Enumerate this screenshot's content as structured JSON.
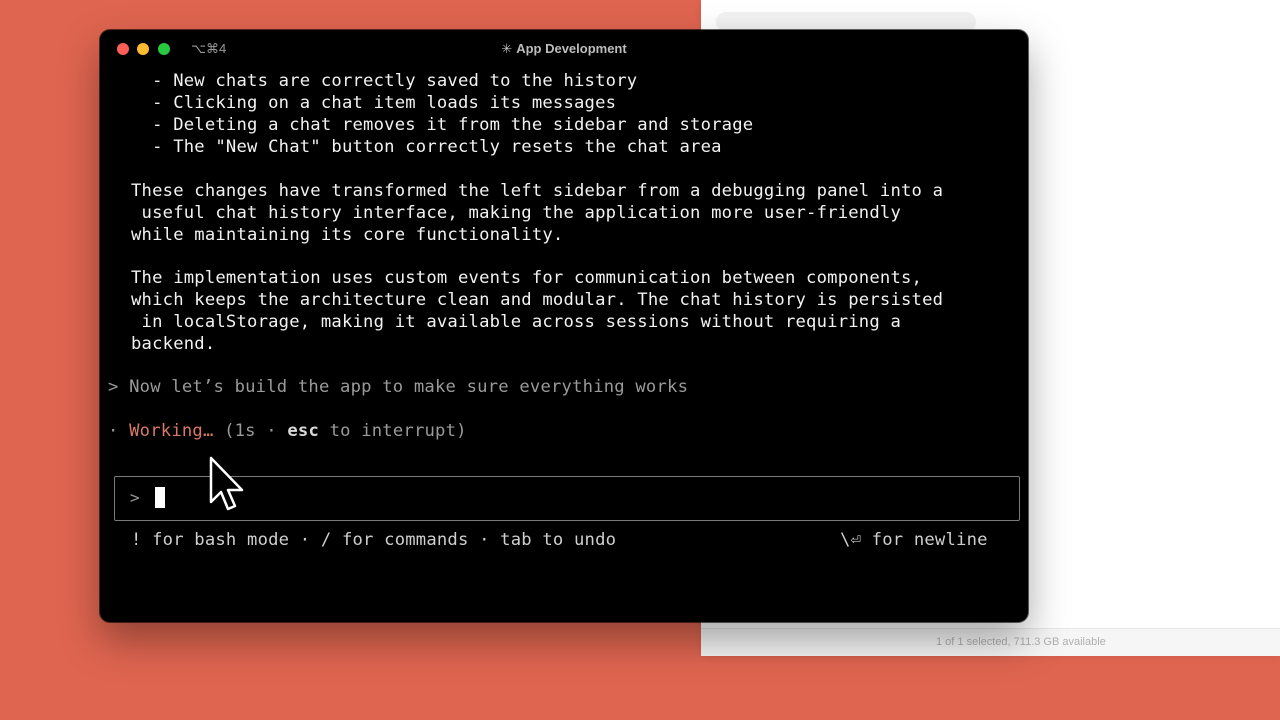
{
  "finder": {
    "status_text": "1 of 1 selected, 711.3 GB available"
  },
  "terminal": {
    "shortcut": "⌥⌘4",
    "title_icon": "✳",
    "title": "App Development",
    "output_lines": [
      "  - New chats are correctly saved to the history",
      "  - Clicking on a chat item loads its messages",
      "  - Deleting a chat removes it from the sidebar and storage",
      "  - The \"New Chat\" button correctly resets the chat area",
      "",
      "These changes have transformed the left sidebar from a debugging panel into a",
      " useful chat history interface, making the application more user-friendly",
      "while maintaining its core functionality.",
      "",
      "The implementation uses custom events for communication between components,",
      "which keeps the architecture clean and modular. The chat history is persisted",
      " in localStorage, making it available across sessions without requiring a",
      "backend."
    ],
    "user_prompt": "> Now let’s build the app to make sure everything works",
    "status": {
      "bullet": "·",
      "working": "Working…",
      "open": " (1s · ",
      "key": "esc",
      "rest": " to interrupt)"
    },
    "input": {
      "prompt": ">",
      "value": ""
    },
    "hints": {
      "left": "! for bash mode · / for commands · tab to undo",
      "right": "\\⏎ for newline"
    }
  },
  "colors": {
    "background": "#df6550",
    "terminal_bg": "#000000",
    "working": "#d97a67"
  }
}
